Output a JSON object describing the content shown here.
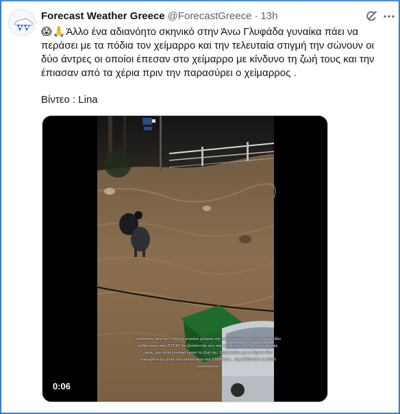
{
  "tweet": {
    "display_name": "Forecast Weather Greece",
    "handle": "@ForecastGreece",
    "separator": "·",
    "time": "13h",
    "emojis": [
      "😱",
      "🙏"
    ],
    "text": "Άλλο ένα αδιανόητο σκηνικό στην Άνω  Γλυφάδα γυναίκα πάει να περάσει με τα πόδια τον χείμαρρο και την τελευταία στιγμή την σώνουν οι δύο άντρες οι οποίοι έπεσαν στο χείμαρρο με κίνδυνο τη ζωή τους και την έπιασαν από τα χέρια πριν την παρασύρει ο χείμαρρος  .",
    "caption": "Βίντεο : Lina"
  },
  "video": {
    "duration": "0:06",
    "overlay_text": "Απίστευτο σκηνικό! Αυτή η γυναίκα γλίτωσε την τελευταία στιγμή, χάρη στους δύο ανθρώπους που ΕΤΥΧΕ να βρίσκονται εκεί και να τη δουν.... Όχι πολύ μακριά, όμως, μια άλλη γυναίκα έχασε τη ζωή της. Παρακαλώ, μη το πάρετε όλοι εγκλωβιστείτε μέσα από αυτοκίνητα στη ΓΛΥΦΑΔΑ... Στη ΓΛΥΦΑΔΑ το 2026! Απαλλαγείτε!"
  },
  "icons": {
    "avatar": "weather-logo-icon",
    "grok": "grok-icon",
    "more": "more-dots-icon"
  },
  "colors": {
    "text": "#0f1419",
    "secondary": "#536471",
    "frame": "#3a7bd5",
    "flood": "#8a6e4e"
  }
}
